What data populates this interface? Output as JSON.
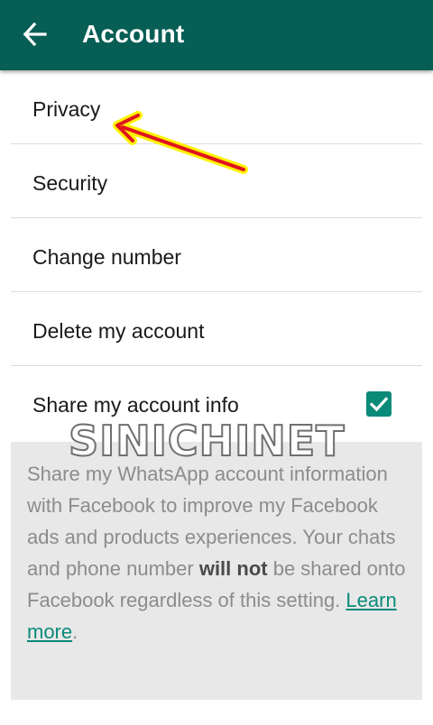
{
  "app_bar": {
    "title": "Account",
    "back_icon": "arrow-back-icon",
    "background_color": "#075e54"
  },
  "menu": {
    "items": [
      {
        "label": "Privacy"
      },
      {
        "label": "Security"
      },
      {
        "label": "Change number"
      },
      {
        "label": "Delete my account"
      }
    ]
  },
  "share_setting": {
    "label": "Share my account info",
    "checked": true,
    "checkbox_color": "#0a8a79",
    "description_pre": "Share my WhatsApp account information with Facebook to improve my Facebook ads and products experiences. Your chats and phone number ",
    "description_bold": "will not",
    "description_post": " be shared onto Facebook regardless of this setting. ",
    "learn_more": "Learn more",
    "period": "."
  },
  "watermark": {
    "text": "SINICHINET"
  },
  "annotation": {
    "arrow_icon": "red-arrow-icon",
    "arrow_color": "#e0141e",
    "arrow_outline_color": "#fff200",
    "points_to": "Privacy"
  }
}
